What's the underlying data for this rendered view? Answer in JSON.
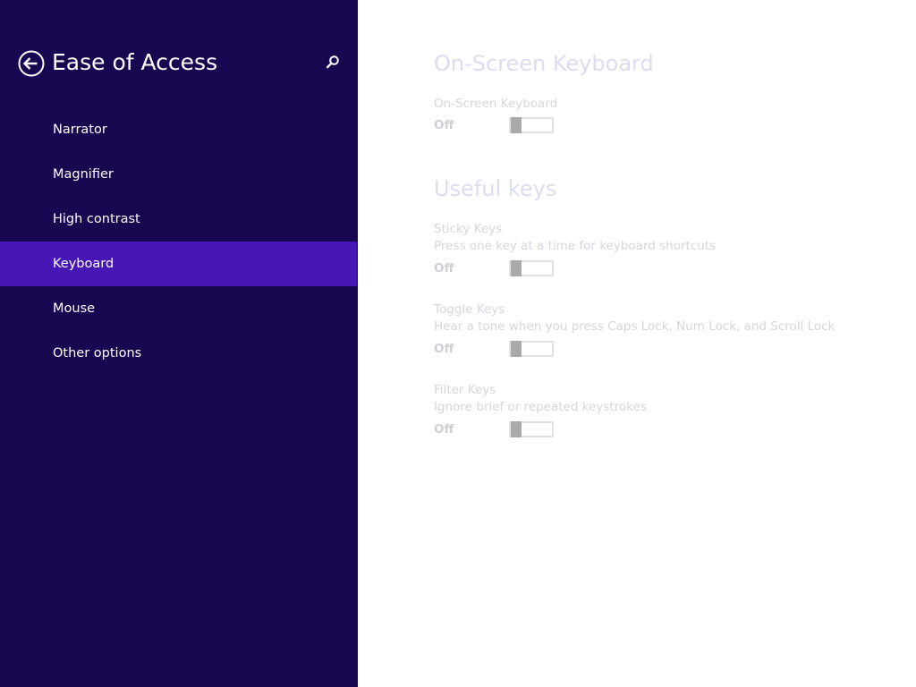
{
  "sidebar": {
    "back_icon": "back-arrow-circle-icon",
    "title": "Ease of Access",
    "search_icon": "search-icon",
    "items": [
      {
        "label": "Narrator",
        "selected": false
      },
      {
        "label": "Magnifier",
        "selected": false
      },
      {
        "label": "High contrast",
        "selected": false
      },
      {
        "label": "Keyboard",
        "selected": true
      },
      {
        "label": "Mouse",
        "selected": false
      },
      {
        "label": "Other options",
        "selected": false
      }
    ]
  },
  "content": {
    "onscreen_heading": "On-Screen Keyboard",
    "onscreen_keyboard": {
      "title": "On-Screen Keyboard",
      "state": "Off",
      "on": false
    },
    "useful_keys_heading": "Useful keys",
    "sticky_keys": {
      "title": "Sticky Keys",
      "description": "Press one key at a time for keyboard shortcuts",
      "state": "Off",
      "on": false
    },
    "toggle_keys": {
      "title": "Toggle Keys",
      "description": "Hear a tone when you press Caps Lock, Num Lock, and Scroll Lock",
      "state": "Off",
      "on": false
    },
    "filter_keys": {
      "title": "Filter Keys",
      "description": "Ignore brief or repeated keystrokes",
      "state": "Off",
      "on": false
    }
  },
  "colors": {
    "sidebar_background": "#180650",
    "selected_item": "#4617b4",
    "content_background": "#ffffff",
    "disabled_text": "#d6d6dc"
  }
}
